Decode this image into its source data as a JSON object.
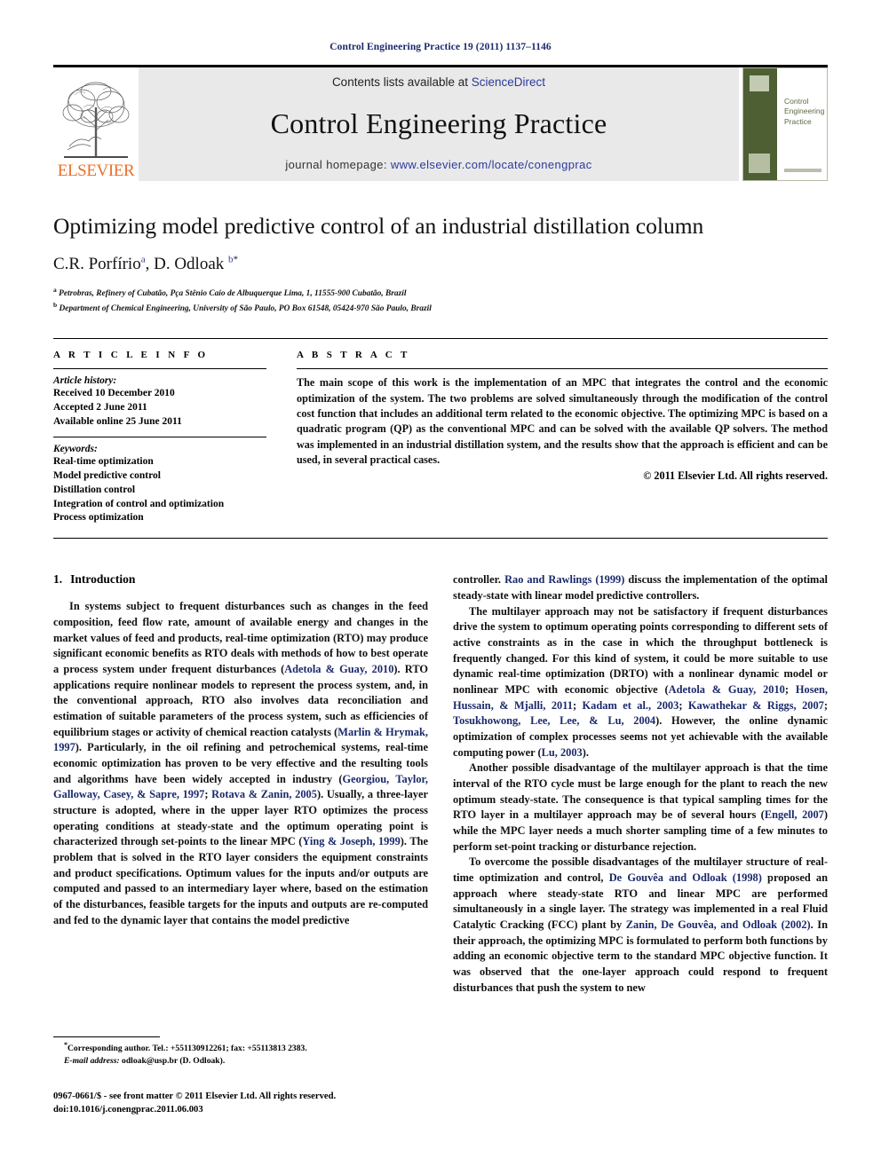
{
  "running_head": "Control Engineering Practice 19 (2011) 1137–1146",
  "masthead": {
    "publisher_name": "ELSEVIER",
    "contents_prefix": "Contents lists available at ",
    "contents_link": "ScienceDirect",
    "journal_title": "Control Engineering Practice",
    "homepage_prefix": "journal homepage: ",
    "homepage_url": "www.elsevier.com/locate/conengprac",
    "cover_title": "Control\nEngineering\nPractice",
    "brand_orange": "#e8702a",
    "link_blue": "#2b3a9c",
    "cover_green": "#4e6033",
    "band_gray": "#e9e9e9"
  },
  "article": {
    "title": "Optimizing model predictive control of an industrial distillation column",
    "authors": "C.R. Porfírio, D. Odloak",
    "author_marks": {
      "a": "a",
      "b": "b",
      "star": "*"
    },
    "affiliations": [
      "Petrobras, Refinery of Cubatão, Pça Stênio Caio de Albuquerque Lima, 1, 11555-900 Cubatão, Brazil",
      "Department of Chemical Engineering, University of São Paulo, PO Box 61548, 05424-970 São Paulo, Brazil"
    ]
  },
  "article_info": {
    "heading": "A R T I C L E   I N F O",
    "history_label": "Article history:",
    "history": [
      "Received 10 December 2010",
      "Accepted 2 June 2011",
      "Available online 25 June 2011"
    ],
    "keywords_label": "Keywords:",
    "keywords": [
      "Real-time optimization",
      "Model predictive control",
      "Distillation control",
      "Integration of control and optimization",
      "Process optimization"
    ]
  },
  "abstract": {
    "heading": "A B S T R A C T",
    "text": "The main scope of this work is the implementation of an MPC that integrates the control and the economic optimization of the system. The two problems are solved simultaneously through the modification of the control cost function that includes an additional term related to the economic objective. The optimizing MPC is based on a quadratic program (QP) as the conventional MPC and can be solved with the available QP solvers. The method was implemented in an industrial distillation system, and the results show that the approach is efficient and can be used, in several practical cases.",
    "copyright": "© 2011 Elsevier Ltd. All rights reserved."
  },
  "body": {
    "section_number": "1.",
    "section_title": "Introduction",
    "left_paragraphs": [
      "In systems subject to frequent disturbances such as changes in the feed composition, feed flow rate, amount of available energy and changes in the market values of feed and products, real-time optimization (RTO) may produce significant economic benefits as RTO deals with methods of how to best operate a process system under frequent disturbances (Adetola & Guay, 2010). RTO applications require nonlinear models to represent the process system, and, in the conventional approach, RTO also involves data reconciliation and estimation of suitable parameters of the process system, such as efficiencies of equilibrium stages or activity of chemical reaction catalysts (Marlin & Hrymak, 1997). Particularly, in the oil refining and petrochemical systems, real-time economic optimization has proven to be very effective and the resulting tools and algorithms have been widely accepted in industry (Georgiou, Taylor, Galloway, Casey, & Sapre, 1997; Rotava & Zanin, 2005). Usually, a three-layer structure is adopted, where in the upper layer RTO optimizes the process operating conditions at steady-state and the optimum operating point is characterized through set-points to the linear MPC (Ying & Joseph, 1999). The problem that is solved in the RTO layer considers the equipment constraints and product specifications. Optimum values for the inputs and/or outputs are computed and passed to an intermediary layer where, based on the estimation of the disturbances, feasible targets for the inputs and outputs are re-computed and fed to the dynamic layer that contains the model predictive"
    ],
    "right_paragraphs": [
      "controller. Rao and Rawlings (1999) discuss the implementation of the optimal steady-state with linear model predictive controllers.",
      "The multilayer approach may not be satisfactory if frequent disturbances drive the system to optimum operating points corresponding to different sets of active constraints as in the case in which the throughput bottleneck is frequently changed. For this kind of system, it could be more suitable to use dynamic real-time optimization (DRTO) with a nonlinear dynamic model or nonlinear MPC with economic objective (Adetola & Guay, 2010; Hosen, Hussain, & Mjalli, 2011; Kadam et al., 2003; Kawathekar & Riggs, 2007; Tosukhowong, Lee, Lee, & Lu, 2004). However, the online dynamic optimization of complex processes seems not yet achievable with the available computing power (Lu, 2003).",
      "Another possible disadvantage of the multilayer approach is that the time interval of the RTO cycle must be large enough for the plant to reach the new optimum steady-state. The consequence is that typical sampling times for the RTO layer in a multilayer approach may be of several hours (Engell, 2007) while the MPC layer needs a much shorter sampling time of a few minutes to perform set-point tracking or disturbance rejection.",
      "To overcome the possible disadvantages of the multilayer structure of real-time optimization and control, De Gouvêa and Odloak (1998) proposed an approach where steady-state RTO and linear MPC are performed simultaneously in a single layer. The strategy was implemented in a real Fluid Catalytic Cracking (FCC) plant by Zanin, De Gouvêa, and Odloak (2002). In their approach, the optimizing MPC is formulated to perform both functions by adding an economic objective term to the standard MPC objective function. It was observed that the one-layer approach could respond to frequent disturbances that push the system to new"
    ],
    "citations": [
      "Adetola & Guay, 2010",
      "Marlin & Hrymak, 1997",
      "Georgiou, Taylor, Galloway, Casey, & Sapre, 1997",
      "Rotava & Zanin, 2005",
      "Ying & Joseph, 1999",
      "Rao and Rawlings (1999)",
      "Hosen, Hussain, & Mjalli, 2011",
      "Kadam et al., 2003",
      "Kawathekar & Riggs, 2007",
      "Tosukhowong, Lee, Lee, & Lu, 2004",
      "Lu, 2003",
      "Engell, 2007",
      "De Gouvêa and Odloak (1998)",
      "Zanin, De Gouvêa, and Odloak (2002)"
    ]
  },
  "footnotes": {
    "corresponding": "Corresponding author. Tel.: +551130912261; fax: +55113813 2383.",
    "email_label": "E-mail address:",
    "email": "odloak@usp.br (D. Odloak)."
  },
  "footer": {
    "issn_line": "0967-0661/$ - see front matter © 2011 Elsevier Ltd. All rights reserved.",
    "doi_line": "doi:10.1016/j.conengprac.2011.06.003"
  }
}
